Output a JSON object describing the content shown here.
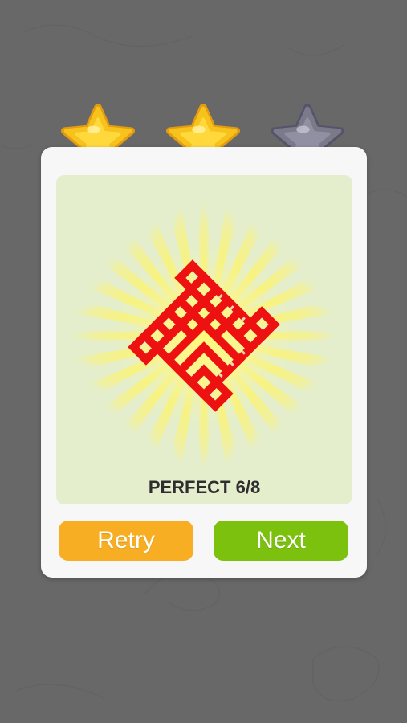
{
  "result": {
    "label": "PERFECT 6/8"
  },
  "rating": {
    "earned": 2,
    "total": 3
  },
  "buttons": {
    "retry_label": "Retry",
    "next_label": "Next"
  },
  "colors": {
    "background": "#686868",
    "card": "#f6f7f6",
    "panel": "#e4eecd",
    "knot": "#ee1111",
    "retry": "#f8ae22",
    "next": "#7cc10e",
    "star_gold": "#f7c21c",
    "star_empty": "#7b7a8a"
  },
  "icons": {
    "star_earned": "gold-star-icon",
    "star_empty": "gray-star-icon",
    "symbol": "endless-knot-icon"
  }
}
